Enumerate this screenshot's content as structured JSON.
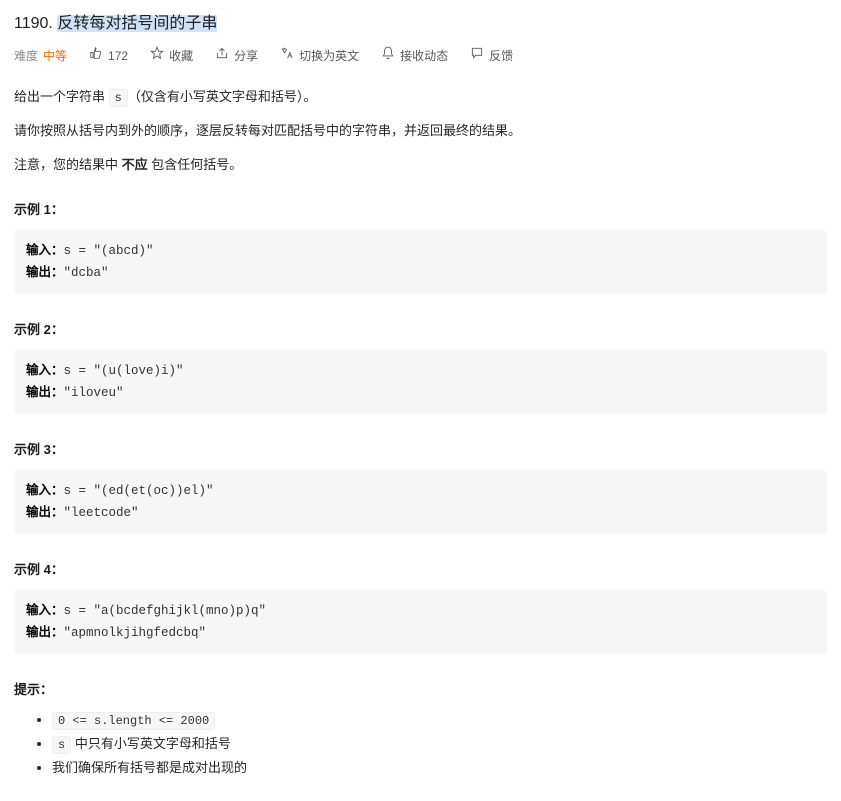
{
  "title": {
    "num": "1190.",
    "hl": "反转每对括号间的子串"
  },
  "meta": {
    "diff_label": "难度",
    "diff_val": "中等",
    "likes": "172",
    "fav": "收藏",
    "share": "分享",
    "lang": "切换为英文",
    "notify": "接收动态",
    "feedback": "反馈"
  },
  "desc": {
    "p1_a": "给出一个字符串 ",
    "p1_code": "s",
    "p1_b": "（仅含有小写英文字母和括号）。",
    "p2": "请你按照从括号内到外的顺序，逐层反转每对匹配括号中的字符串，并返回最终的结果。",
    "p3_a": "注意，您的结果中 ",
    "p3_strong": "不应",
    "p3_b": " 包含任何括号。"
  },
  "ex_label_in": "输入：",
  "ex_label_out": "输出：",
  "examples": [
    {
      "title": "示例 1：",
      "input": "s = \"(abcd)\"",
      "output": "\"dcba\""
    },
    {
      "title": "示例 2：",
      "input": "s = \"(u(love)i)\"",
      "output": "\"iloveu\""
    },
    {
      "title": "示例 3：",
      "input": "s = \"(ed(et(oc))el)\"",
      "output": "\"leetcode\""
    },
    {
      "title": "示例 4：",
      "input": "s = \"a(bcdefghijkl(mno)p)q\"",
      "output": "\"apmnolkjihgfedcbq\""
    }
  ],
  "hints_title": "提示：",
  "hints": {
    "h1_code": "0 <= s.length <= 2000",
    "h2_code": "s",
    "h2_text": " 中只有小写英文字母和括号",
    "h3": "我们确保所有括号都是成对出现的"
  }
}
